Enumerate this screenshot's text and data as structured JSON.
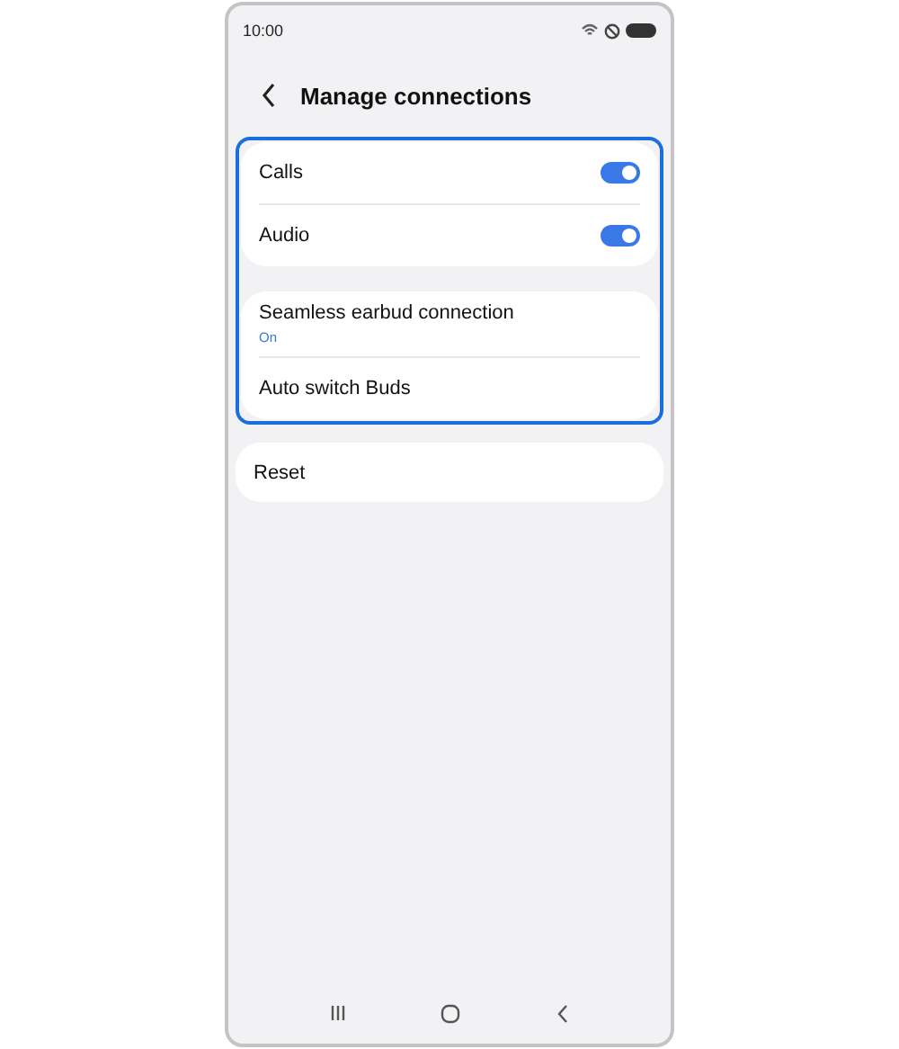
{
  "status_bar": {
    "time": "10:00"
  },
  "header": {
    "title": "Manage connections"
  },
  "highlight": {
    "highlighted": true,
    "cards": [
      {
        "items": [
          {
            "kind": "toggle",
            "label": "Calls",
            "on": true
          },
          {
            "kind": "toggle",
            "label": "Audio",
            "on": true
          }
        ]
      },
      {
        "items": [
          {
            "kind": "text",
            "label": "Seamless earbud connection",
            "subtitle": "On"
          },
          {
            "kind": "text",
            "label": "Auto switch Buds"
          }
        ]
      }
    ]
  },
  "cards": [
    {
      "items": [
        {
          "label": "Reset"
        }
      ]
    }
  ]
}
